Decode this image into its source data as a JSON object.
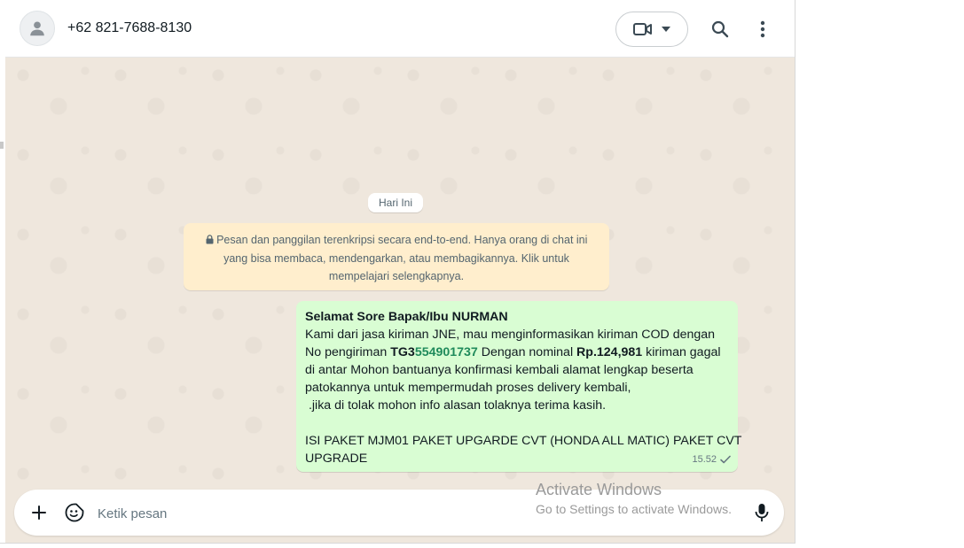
{
  "header": {
    "contact_name": "+62 821-7688-8130",
    "icons": [
      "person-icon",
      "video-icon",
      "chevron-down-icon",
      "search-icon",
      "more-vertical-icon"
    ]
  },
  "chat": {
    "day_label": "Hari Ini",
    "encryption_notice": {
      "line1": "Pesan dan panggilan terenkripsi secara end-to-end. Hanya orang di chat ini",
      "line2": "yang bisa membaca, mendengarkan, atau membagikannya. Klik untuk",
      "line3": "mempelajari selengkapnya."
    },
    "message": {
      "greeting": "Selamat Sore Bapak/Ibu NURMAN",
      "line1": "Kami dari jasa kiriman JNE, mau menginformasikan kiriman COD dengan",
      "line2_prefix": "No pengiriman ",
      "tracking_prefix": "TG3",
      "tracking_number": "554901737",
      "line2_mid": " Dengan nominal ",
      "amount": "Rp.124,981",
      "line2_suffix": " kiriman gagal",
      "line3": "di antar Mohon bantuanya konfirmasi kembali alamat lengkap beserta",
      "line4": "patokannya untuk mempermudah proses delivery kembali,",
      "line5": " .jika di tolak mohon info alasan tolaknya terima kasih.",
      "line6": "ISI PAKET MJM01 PAKET UPGARDE CVT (HONDA ALL MATIC) PAKET CVT",
      "line7": "UPGRADE",
      "time": "15.52",
      "status": "sent"
    }
  },
  "composer": {
    "placeholder": "Ketik pesan"
  },
  "watermark": {
    "title": "Activate Windows",
    "subtitle": "Go to Settings to activate Windows."
  },
  "colors": {
    "bubble_out": "#d9fdd3",
    "chat_bg": "#efe7dd",
    "notice_bg": "#ffeecd",
    "link_green": "#1f8a5b"
  }
}
